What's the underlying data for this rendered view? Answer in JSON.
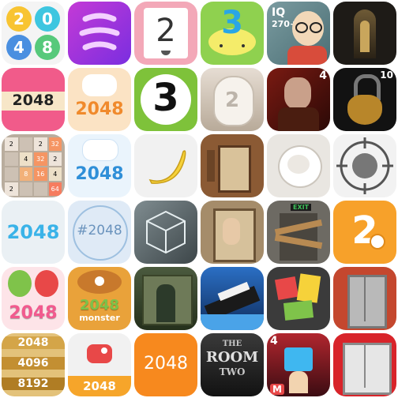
{
  "texts": {
    "r1c3": "2",
    "r1c4": "3",
    "r1c5_iq": "IQ",
    "r1c5_score": "270+",
    "r2c1": "2048",
    "r2c2": "2048",
    "r2c3": "3",
    "r2c4": "2",
    "r2c5": "4",
    "r2c6": "10",
    "r3c2": "2048",
    "r4c1": "2048",
    "r4c2": "#2048",
    "r4c5": "EXIT",
    "r4c6": "2",
    "r5c1": "2048",
    "r5c2_a": "2048",
    "r5c2_b": "monster",
    "r6c1": [
      "2048",
      "4096",
      "8192"
    ],
    "r6c2": "2048",
    "r6c3": "2048",
    "r6c4_a": "THE",
    "r6c4_b": "ROOM",
    "r6c4_c": "TWO",
    "r6c5": "4",
    "r6c5_m": "M"
  },
  "tiles_r1c1": [
    "2",
    "0",
    "4",
    "8"
  ],
  "board_r3c1": [
    "2",
    "",
    "2",
    "32",
    "",
    "4",
    "32",
    "2",
    "",
    "8",
    "16",
    "4",
    "2",
    "",
    "",
    "64"
  ]
}
